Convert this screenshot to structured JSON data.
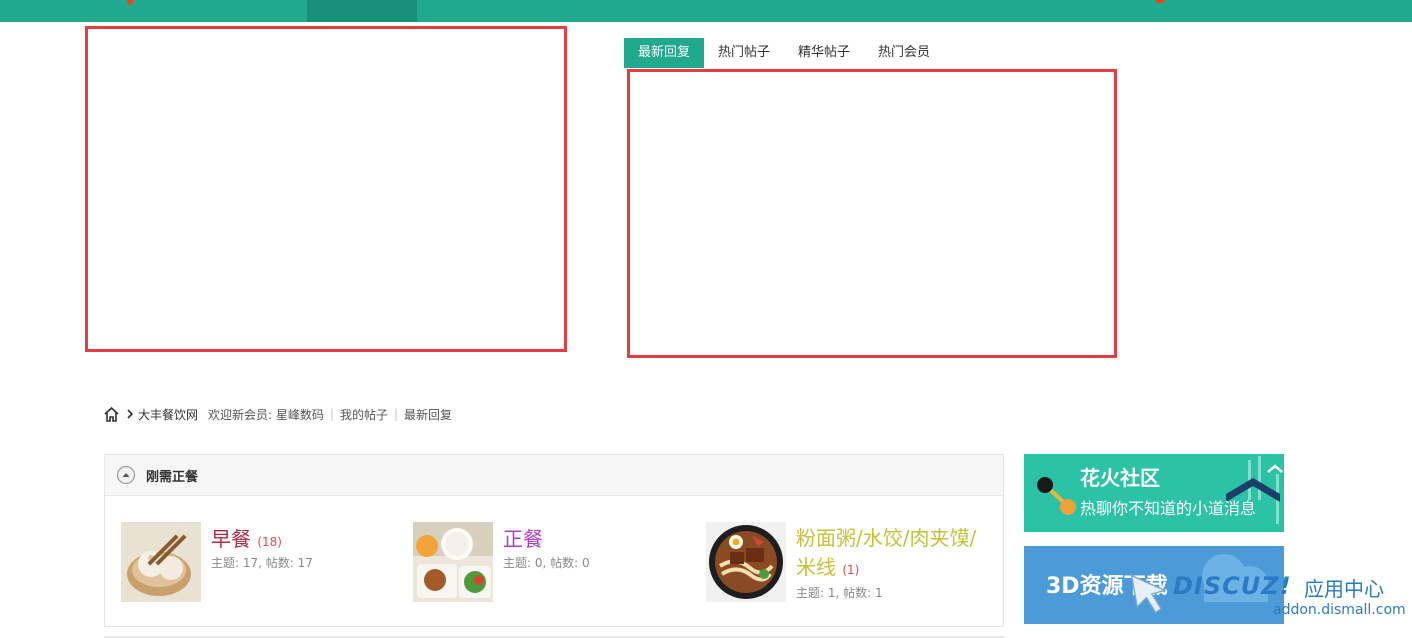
{
  "tabs": {
    "latest_replies": "最新回复",
    "hot_threads": "热门帖子",
    "digest_threads": "精华帖子",
    "hot_members": "热门会员"
  },
  "breadcrumb": {
    "site_name": "大丰餐饮网",
    "welcome_text": "欢迎新会员:",
    "new_member": "星峰数码",
    "my_threads": "我的帖子",
    "latest_replies": "最新回复"
  },
  "forum_group": {
    "title": "刚需正餐",
    "forums": [
      {
        "name": "早餐",
        "count": "(18)",
        "stats": "主题: 17, 帖数: 17"
      },
      {
        "name": "正餐",
        "count": "",
        "stats": "主题: 0, 帖数: 0"
      },
      {
        "name": "粉面粥/水饺/肉夹馍/米线",
        "count": "(1)",
        "stats": "主题: 1, 帖数: 1"
      }
    ]
  },
  "ads": {
    "ad1_title": "花火社区",
    "ad1_subtitle": "热聊你不知道的小道消息",
    "ad2_title": "3D资源下载"
  },
  "watermark": {
    "logo": "DISCUZ!",
    "center": "应用中心",
    "url": "addon.dismall.com"
  },
  "colors": {
    "brand": "#20a98c",
    "highlight_border": "#e53e3e",
    "forum_1": "#b22a3f",
    "forum_2": "#b13cc9",
    "forum_3": "#c8c13a"
  }
}
